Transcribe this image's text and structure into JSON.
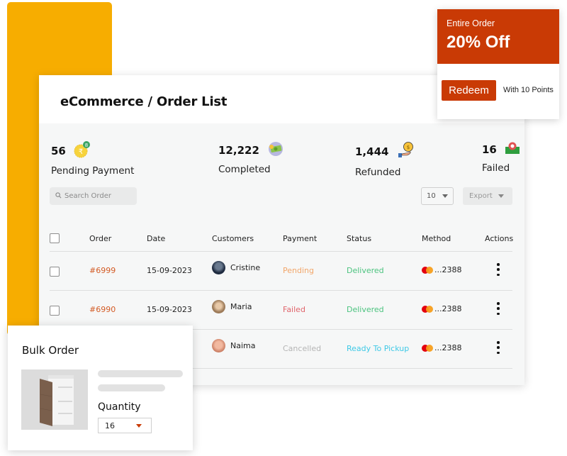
{
  "main": {
    "title": "eCommerce / Order List",
    "stats": [
      {
        "value": "56",
        "label": "Pending Payment",
        "icon": "rupee-coin-icon"
      },
      {
        "value": "12,222",
        "label": "Completed",
        "icon": "cash-icon"
      },
      {
        "value": "1,444",
        "label": "Refunded",
        "icon": "refund-hand-coin-icon"
      },
      {
        "value": "16",
        "label": "Failed",
        "icon": "failed-cash-icon"
      }
    ],
    "search": {
      "placeholder": "Search Order"
    },
    "page_size": "10",
    "export_label": "Export",
    "table": {
      "headers": [
        "Order",
        "Date",
        "Customers",
        "Payment",
        "Status",
        "Method",
        "Actions"
      ],
      "rows": [
        {
          "order": "#6999",
          "date": "15-09-2023",
          "customer": "Cristine",
          "payment": "Pending",
          "status": "Delivered",
          "method": "...2388"
        },
        {
          "order": "#6990",
          "date": "15-09-2023",
          "customer": "Maria",
          "payment": "Failed",
          "status": "Delivered",
          "method": "...2388"
        },
        {
          "order": "",
          "date": "",
          "customer": "Naima",
          "payment": "Cancelled",
          "status": "Ready To Pickup",
          "method": "...2388"
        }
      ]
    }
  },
  "colors": {
    "accent": "#C93A05",
    "yellow": "#F7AD00",
    "pending": "#F2A66A",
    "failed": "#E0646B",
    "cancelled": "#B5B5B5",
    "delivered": "#4CC37F",
    "ready": "#3FC9E6"
  },
  "coupon": {
    "subtitle": "Entire Order",
    "title": "20% Off",
    "button": "Redeem",
    "note": "With 10 Points"
  },
  "bulk_order": {
    "title": "Bulk Order",
    "quantity_label": "Quantity",
    "quantity_value": "16"
  }
}
